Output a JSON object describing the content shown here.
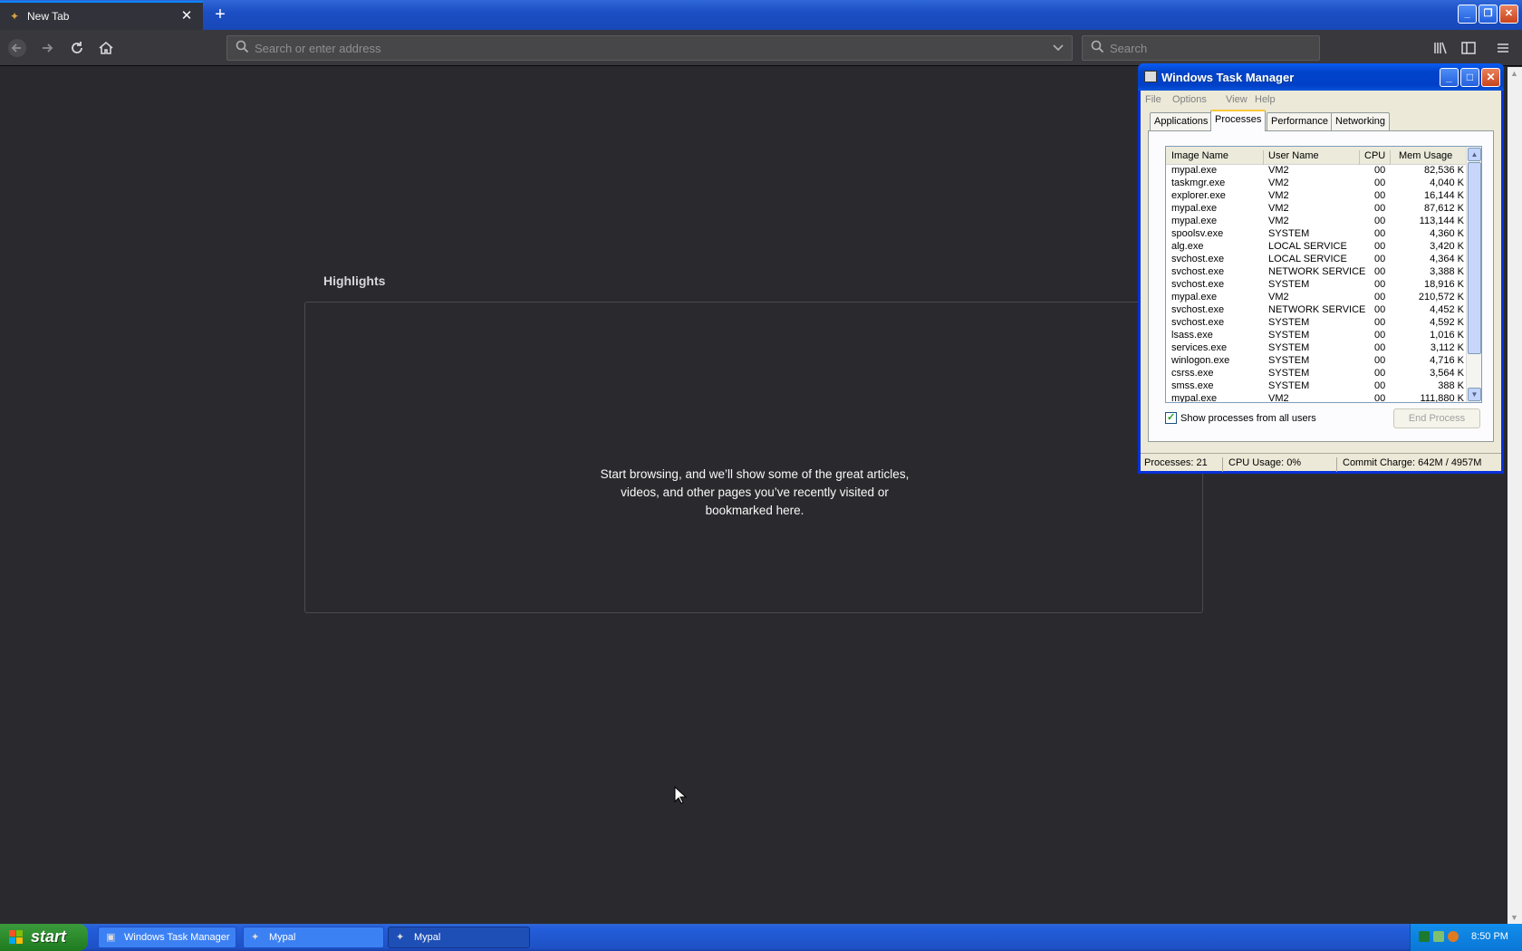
{
  "browser": {
    "tab": {
      "title": "New Tab",
      "favicon": "mypal-icon",
      "close": "✕"
    },
    "new_tab_symbol": "+",
    "urlbar": {
      "placeholder": "Search or enter address"
    },
    "searchbar": {
      "placeholder": "Search"
    },
    "nav_icons": [
      "back-icon",
      "forward-icon",
      "reload-icon",
      "home-icon"
    ],
    "toolbar_icons": [
      "library-icon",
      "sidebar-icon",
      "menu-icon"
    ]
  },
  "newtab": {
    "highlights_title": "Highlights",
    "message_lines": [
      "Start browsing, and we’ll show some of the great articles,",
      "videos, and other pages you’ve recently visited or",
      "bookmarked here."
    ]
  },
  "taskmgr": {
    "title": "Windows Task Manager",
    "menu": [
      "File",
      "Options",
      "View",
      "Help"
    ],
    "tabs": [
      "Applications",
      "Processes",
      "Performance",
      "Networking"
    ],
    "active_tab": "Processes",
    "columns": {
      "image": "Image Name",
      "user": "User Name",
      "cpu": "CPU",
      "mem": "Mem Usage"
    },
    "rows": [
      {
        "image": "mypal.exe",
        "user": "VM2",
        "cpu": "00",
        "mem": "82,536 K"
      },
      {
        "image": "taskmgr.exe",
        "user": "VM2",
        "cpu": "00",
        "mem": "4,040 K"
      },
      {
        "image": "explorer.exe",
        "user": "VM2",
        "cpu": "00",
        "mem": "16,144 K"
      },
      {
        "image": "mypal.exe",
        "user": "VM2",
        "cpu": "00",
        "mem": "87,612 K"
      },
      {
        "image": "mypal.exe",
        "user": "VM2",
        "cpu": "00",
        "mem": "113,144 K"
      },
      {
        "image": "spoolsv.exe",
        "user": "SYSTEM",
        "cpu": "00",
        "mem": "4,360 K"
      },
      {
        "image": "alg.exe",
        "user": "LOCAL SERVICE",
        "cpu": "00",
        "mem": "3,420 K"
      },
      {
        "image": "svchost.exe",
        "user": "LOCAL SERVICE",
        "cpu": "00",
        "mem": "4,364 K"
      },
      {
        "image": "svchost.exe",
        "user": "NETWORK SERVICE",
        "cpu": "00",
        "mem": "3,388 K"
      },
      {
        "image": "svchost.exe",
        "user": "SYSTEM",
        "cpu": "00",
        "mem": "18,916 K"
      },
      {
        "image": "mypal.exe",
        "user": "VM2",
        "cpu": "00",
        "mem": "210,572 K"
      },
      {
        "image": "svchost.exe",
        "user": "NETWORK SERVICE",
        "cpu": "00",
        "mem": "4,452 K"
      },
      {
        "image": "svchost.exe",
        "user": "SYSTEM",
        "cpu": "00",
        "mem": "4,592 K"
      },
      {
        "image": "lsass.exe",
        "user": "SYSTEM",
        "cpu": "00",
        "mem": "1,016 K"
      },
      {
        "image": "services.exe",
        "user": "SYSTEM",
        "cpu": "00",
        "mem": "3,112 K"
      },
      {
        "image": "winlogon.exe",
        "user": "SYSTEM",
        "cpu": "00",
        "mem": "4,716 K"
      },
      {
        "image": "csrss.exe",
        "user": "SYSTEM",
        "cpu": "00",
        "mem": "3,564 K"
      },
      {
        "image": "smss.exe",
        "user": "SYSTEM",
        "cpu": "00",
        "mem": "388 K"
      },
      {
        "image": "mypal.exe",
        "user": "VM2",
        "cpu": "00",
        "mem": "111,880 K"
      }
    ],
    "show_all_label": "Show processes from all users",
    "show_all_checked": true,
    "end_process_label": "End Process",
    "status": {
      "processes": "Processes: 21",
      "cpu": "CPU Usage: 0%",
      "commit": "Commit Charge: 642M / 4957M"
    }
  },
  "taskbar": {
    "start_label": "start",
    "items": [
      {
        "label": "Windows Task Manager",
        "icon": "taskmgr-icon"
      },
      {
        "label": "Mypal",
        "icon": "mypal-icon"
      },
      {
        "label": "Mypal",
        "icon": "mypal-icon",
        "active": true
      }
    ],
    "clock": "8:50 PM"
  }
}
